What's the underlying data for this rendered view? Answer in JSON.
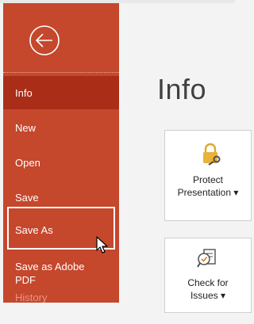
{
  "sidebar": {
    "items": [
      {
        "label": "Info",
        "state": "active"
      },
      {
        "label": "New"
      },
      {
        "label": "Open"
      },
      {
        "label": "Save"
      },
      {
        "label": "Save As",
        "state": "highlighted"
      },
      {
        "label_line1": "Save as Adobe",
        "label_line2": "PDF"
      },
      {
        "label": "History",
        "state": "dim"
      }
    ]
  },
  "main": {
    "title": "Info",
    "cards": [
      {
        "line1": "Protect",
        "line2": "Presentation",
        "icon": "lock-key-icon"
      },
      {
        "line1": "Check for",
        "line2": "Issues",
        "icon": "inspect-document-icon"
      }
    ]
  },
  "colors": {
    "sidebar": "#c5472c",
    "active": "#a92d17",
    "content_bg": "#f3f3f3"
  }
}
